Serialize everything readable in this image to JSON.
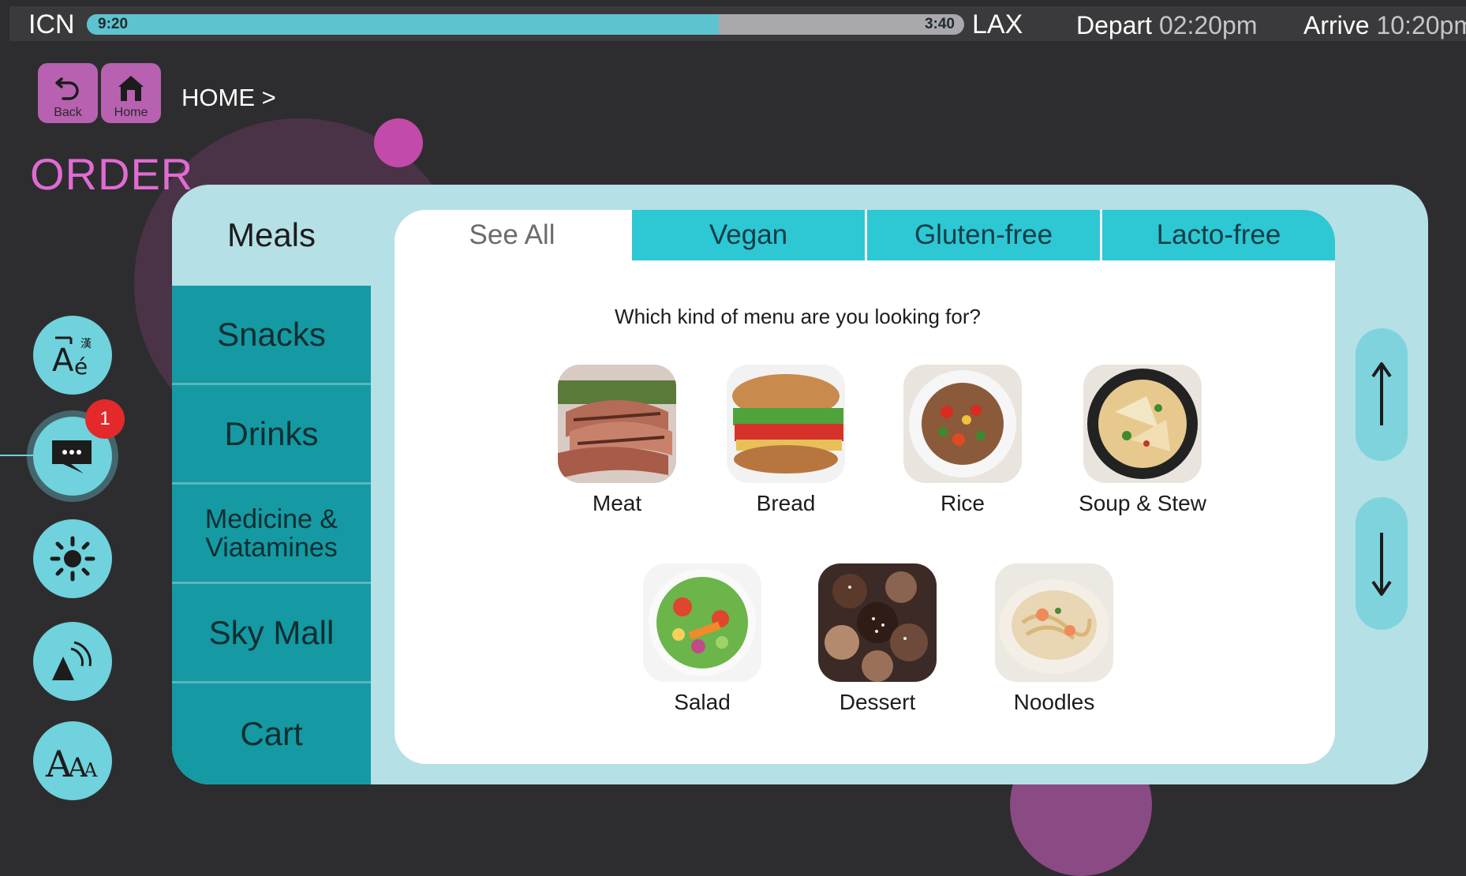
{
  "flight": {
    "origin": "ICN",
    "destination": "LAX",
    "elapsed": "9:20",
    "remaining": "3:40",
    "progress_percent": 72,
    "depart_label": "Depart",
    "depart_time": "02:20pm",
    "arrive_label": "Arrive",
    "arrive_time": "10:20pm"
  },
  "nav": {
    "back_label": "Back",
    "home_label": "Home",
    "breadcrumb": "HOME >"
  },
  "page_title": "ORDER",
  "notifications": {
    "count": "1"
  },
  "categories": {
    "meals": "Meals",
    "snacks": "Snacks",
    "drinks": "Drinks",
    "medicine": "Medicine & Viatamines",
    "sky_mall": "Sky Mall",
    "cart": "Cart"
  },
  "tabs": [
    "See All",
    "Vegan",
    "Gluten-free",
    "Lacto-free"
  ],
  "question": "Which kind of menu are you looking for?",
  "foods": [
    "Meat",
    "Bread",
    "Rice",
    "Soup & Stew",
    "Salad",
    "Dessert",
    "Noodles"
  ],
  "colors": {
    "accent": "#6fd2dd",
    "brand": "#e06bd3",
    "teal": "#1599a3",
    "badge": "#e32929"
  }
}
